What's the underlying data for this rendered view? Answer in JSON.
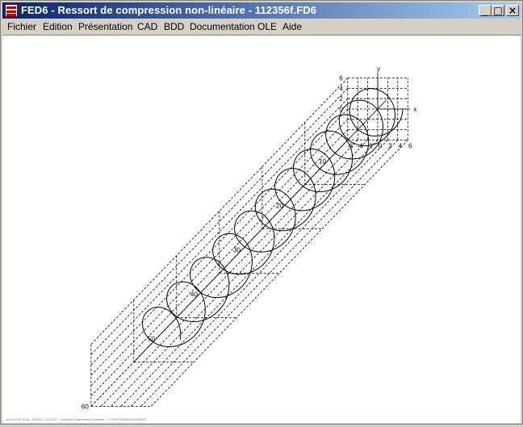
{
  "window": {
    "title": "FED6 - Ressort de compression non-linéaire  -  112356f.FD6",
    "buttons": {
      "minimize": "_",
      "maximize": "□",
      "close": "×"
    }
  },
  "menu": [
    {
      "name": "fichier",
      "label": "Fichier"
    },
    {
      "name": "edition",
      "label": "Edition"
    },
    {
      "name": "presentation",
      "label": "Présentation"
    },
    {
      "name": "cad",
      "label": "CAD"
    },
    {
      "name": "bdd",
      "label": "BDD"
    },
    {
      "name": "documentation",
      "label": "Documentation"
    },
    {
      "name": "ole",
      "label": "OLE"
    },
    {
      "name": "aide",
      "label": "Aide"
    }
  ],
  "drawing": {
    "axis_x": "x",
    "axis_y": "y",
    "y_ticks": [
      "6",
      "4",
      "2",
      "0",
      "-2",
      "-4",
      "-6"
    ],
    "x_ticks": [
      "-6",
      "-4",
      "-2",
      "0",
      "2",
      "4",
      "6"
    ],
    "z_ticks": [
      "0",
      "10",
      "20",
      "30",
      "40",
      "50",
      "60"
    ],
    "coil_turns": 12
  },
  "status": {
    "footer_text": "16.04.2007 8:58 · FED6 V 7.0 B710 · Hexagon Engineering Software · C:\\SOFTWARE\\FED6\\BSP"
  }
}
